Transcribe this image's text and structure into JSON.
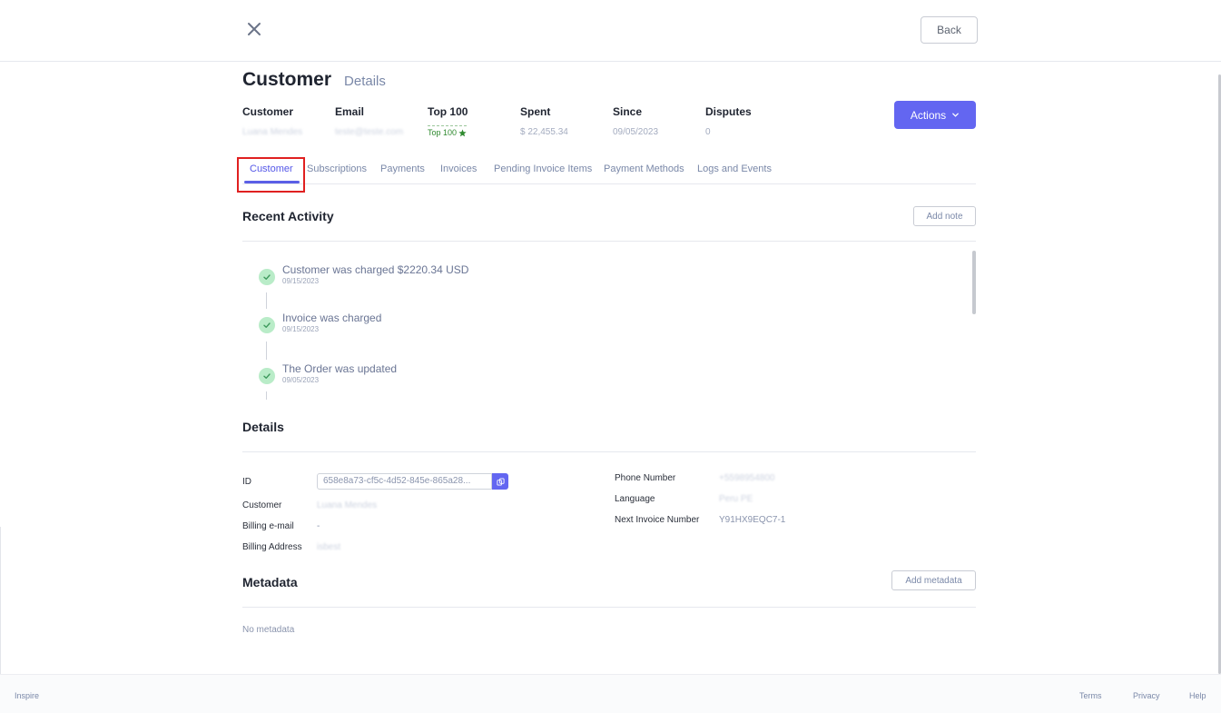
{
  "header": {
    "close_icon": "close-icon",
    "back_label": "Back"
  },
  "title": {
    "main": "Customer",
    "sub": "Details"
  },
  "summary": {
    "customer": {
      "label": "Customer",
      "value": "Luana Mendes"
    },
    "email": {
      "label": "Email",
      "value": "teste@teste.com"
    },
    "top100": {
      "label": "Top 100",
      "badge": "Top 100"
    },
    "spent": {
      "label": "Spent",
      "value": "$ 22,455.34"
    },
    "since": {
      "label": "Since",
      "value": "09/05/2023"
    },
    "disputes": {
      "label": "Disputes",
      "value": "0"
    }
  },
  "actions_label": "Actions",
  "tabs": [
    {
      "label": "Customer",
      "active": true
    },
    {
      "label": "Subscriptions"
    },
    {
      "label": "Payments"
    },
    {
      "label": "Invoices"
    },
    {
      "label": "Pending Invoice Items"
    },
    {
      "label": "Payment Methods"
    },
    {
      "label": "Logs and Events"
    }
  ],
  "recent_activity": {
    "title": "Recent Activity",
    "add_note_label": "Add note",
    "items": [
      {
        "text": "Customer was charged $2220.34 USD",
        "date": "09/15/2023"
      },
      {
        "text": "Invoice was charged",
        "date": "09/15/2023"
      },
      {
        "text": "The Order was updated",
        "date": "09/05/2023"
      }
    ]
  },
  "details": {
    "title": "Details",
    "id_label": "ID",
    "id_value": "658e8a73-cf5c-4d52-845e-865a28...",
    "customer_label": "Customer",
    "customer_value": "Luana Mendes",
    "billing_email_label": "Billing e-mail",
    "billing_email_value": "-",
    "billing_address_label": "Billing Address",
    "billing_address_value": "isbest",
    "phone_label": "Phone Number",
    "phone_value": "+5598954800",
    "language_label": "Language",
    "language_value": "Peru PE",
    "next_invoice_label": "Next Invoice Number",
    "next_invoice_value": "Y91HX9EQC7-1"
  },
  "metadata": {
    "title": "Metadata",
    "add_label": "Add metadata",
    "empty_text": "No metadata"
  },
  "footer": {
    "brand": "Inspire",
    "terms": "Terms",
    "privacy": "Privacy",
    "help": "Help"
  },
  "colors": {
    "accent": "#6366f1",
    "success_bg": "#b9ecc8",
    "highlight": "#e02020"
  }
}
